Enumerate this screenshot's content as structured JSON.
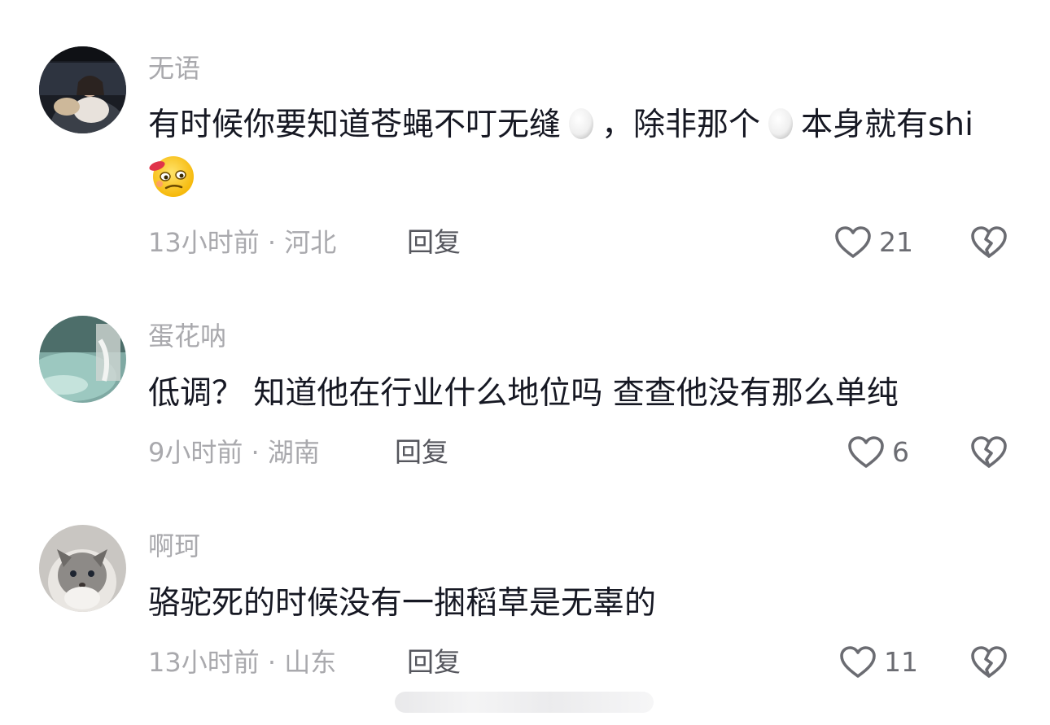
{
  "comments": [
    {
      "username": "无语",
      "text_before": "有时候你要知道苍蝇不叮无缝",
      "egg_1": "🥚",
      "text_mid": "，除非那个",
      "egg_2": "🥚",
      "text_after": "本身就有shi",
      "face": "🥴",
      "time_location": "13小时前 · 河北",
      "reply_label": "回复",
      "like_count": "21"
    },
    {
      "username": "蛋花呐",
      "text": "低调？ 知道他在行业什么地位吗 查查他没有那么单纯",
      "time_location": "9小时前 · 湖南",
      "reply_label": "回复",
      "like_count": "6"
    },
    {
      "username": "啊珂",
      "text": "骆驼死的时候没有一捆稻草是无辜的",
      "time_location": "13小时前 · 山东",
      "reply_label": "回复",
      "like_count": "11"
    }
  ],
  "icons": {
    "like": "heart-outline-icon",
    "dislike": "broken-heart-outline-icon"
  },
  "colors": {
    "username": "#a9a9ad",
    "content": "#161823",
    "meta": "#a9a9ad",
    "reply": "#55565d",
    "icon": "#6b6c72"
  }
}
